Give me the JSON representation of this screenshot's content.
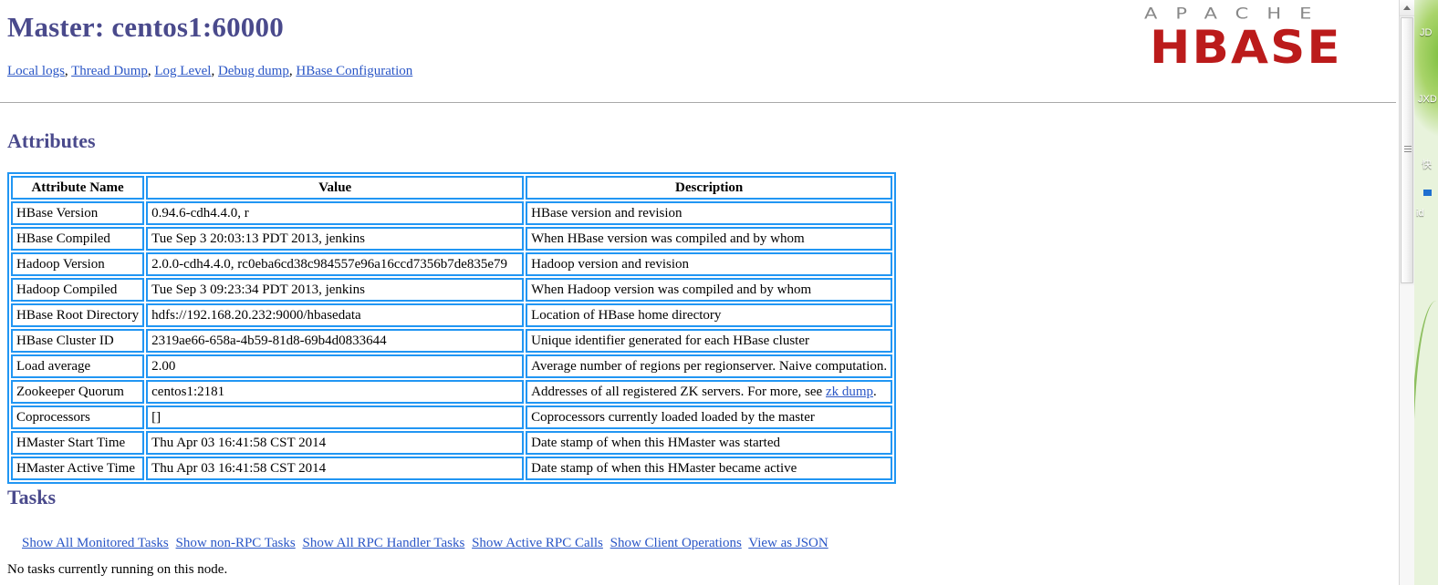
{
  "page": {
    "title": "Master: centos1:60000",
    "logo": {
      "apache": "APACHE",
      "hbase": "HBASE"
    },
    "accent_heading_color": "#4a4a8c",
    "link_color": "#2a56c6",
    "table_border_color": "#2196f3",
    "logo_red": "#bb1b1b",
    "logo_gray": "#888888"
  },
  "quick_links": [
    {
      "label": "Local logs"
    },
    {
      "label": "Thread Dump"
    },
    {
      "label": "Log Level"
    },
    {
      "label": "Debug dump"
    },
    {
      "label": "HBase Configuration"
    }
  ],
  "attributes": {
    "heading": "Attributes",
    "columns": [
      "Attribute Name",
      "Value",
      "Description"
    ],
    "rows": [
      {
        "name": "HBase Version",
        "value": "0.94.6-cdh4.4.0, r",
        "description": "HBase version and revision"
      },
      {
        "name": "HBase Compiled",
        "value": "Tue Sep 3 20:03:13 PDT 2013, jenkins",
        "description": "When HBase version was compiled and by whom"
      },
      {
        "name": "Hadoop Version",
        "value": "2.0.0-cdh4.4.0, rc0eba6cd38c984557e96a16ccd7356b7de835e79",
        "description": "Hadoop version and revision"
      },
      {
        "name": "Hadoop Compiled",
        "value": "Tue Sep 3 09:23:34 PDT 2013, jenkins",
        "description": "When Hadoop version was compiled and by whom"
      },
      {
        "name": "HBase Root Directory",
        "value": "hdfs://192.168.20.232:9000/hbasedata",
        "description": "Location of HBase home directory"
      },
      {
        "name": "HBase Cluster ID",
        "value": "2319ae66-658a-4b59-81d8-69b4d0833644",
        "description": "Unique identifier generated for each HBase cluster"
      },
      {
        "name": "Load average",
        "value": "2.00",
        "description": "Average number of regions per regionserver. Naive computation."
      },
      {
        "name": "Zookeeper Quorum",
        "value": "centos1:2181",
        "description": "Addresses of all registered ZK servers. For more, see ",
        "description_link": "zk dump",
        "description_tail": "."
      },
      {
        "name": "Coprocessors",
        "value": "[]",
        "description": "Coprocessors currently loaded loaded by the master"
      },
      {
        "name": "HMaster Start Time",
        "value": "Thu Apr 03 16:41:58 CST 2014",
        "description": "Date stamp of when this HMaster was started"
      },
      {
        "name": "HMaster Active Time",
        "value": "Thu Apr 03 16:41:58 CST 2014",
        "description": "Date stamp of when this HMaster became active"
      }
    ]
  },
  "tasks": {
    "heading": "Tasks",
    "links": [
      "Show All Monitored Tasks",
      "Show non-RPC Tasks",
      "Show All RPC Handler Tasks",
      "Show Active RPC Calls",
      "Show Client Operations",
      "View as JSON"
    ],
    "empty_message": "No tasks currently running on this node."
  },
  "desktop": {
    "icon_labels": [
      "JD",
      "JXD",
      "快",
      "id"
    ]
  }
}
